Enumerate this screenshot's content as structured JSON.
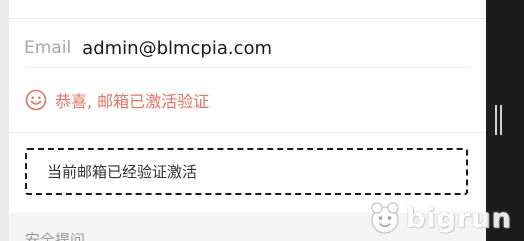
{
  "email": {
    "label": "Email",
    "value": "admin@blmcpia.com"
  },
  "success_message": {
    "icon": "smile-icon",
    "text": "恭喜, 邮箱已激活验证",
    "color": "#e8735f"
  },
  "status_box": {
    "text": "当前邮箱已经验证激活"
  },
  "next_section": {
    "label": "安全提问"
  },
  "watermark": {
    "text": "bigrun"
  }
}
